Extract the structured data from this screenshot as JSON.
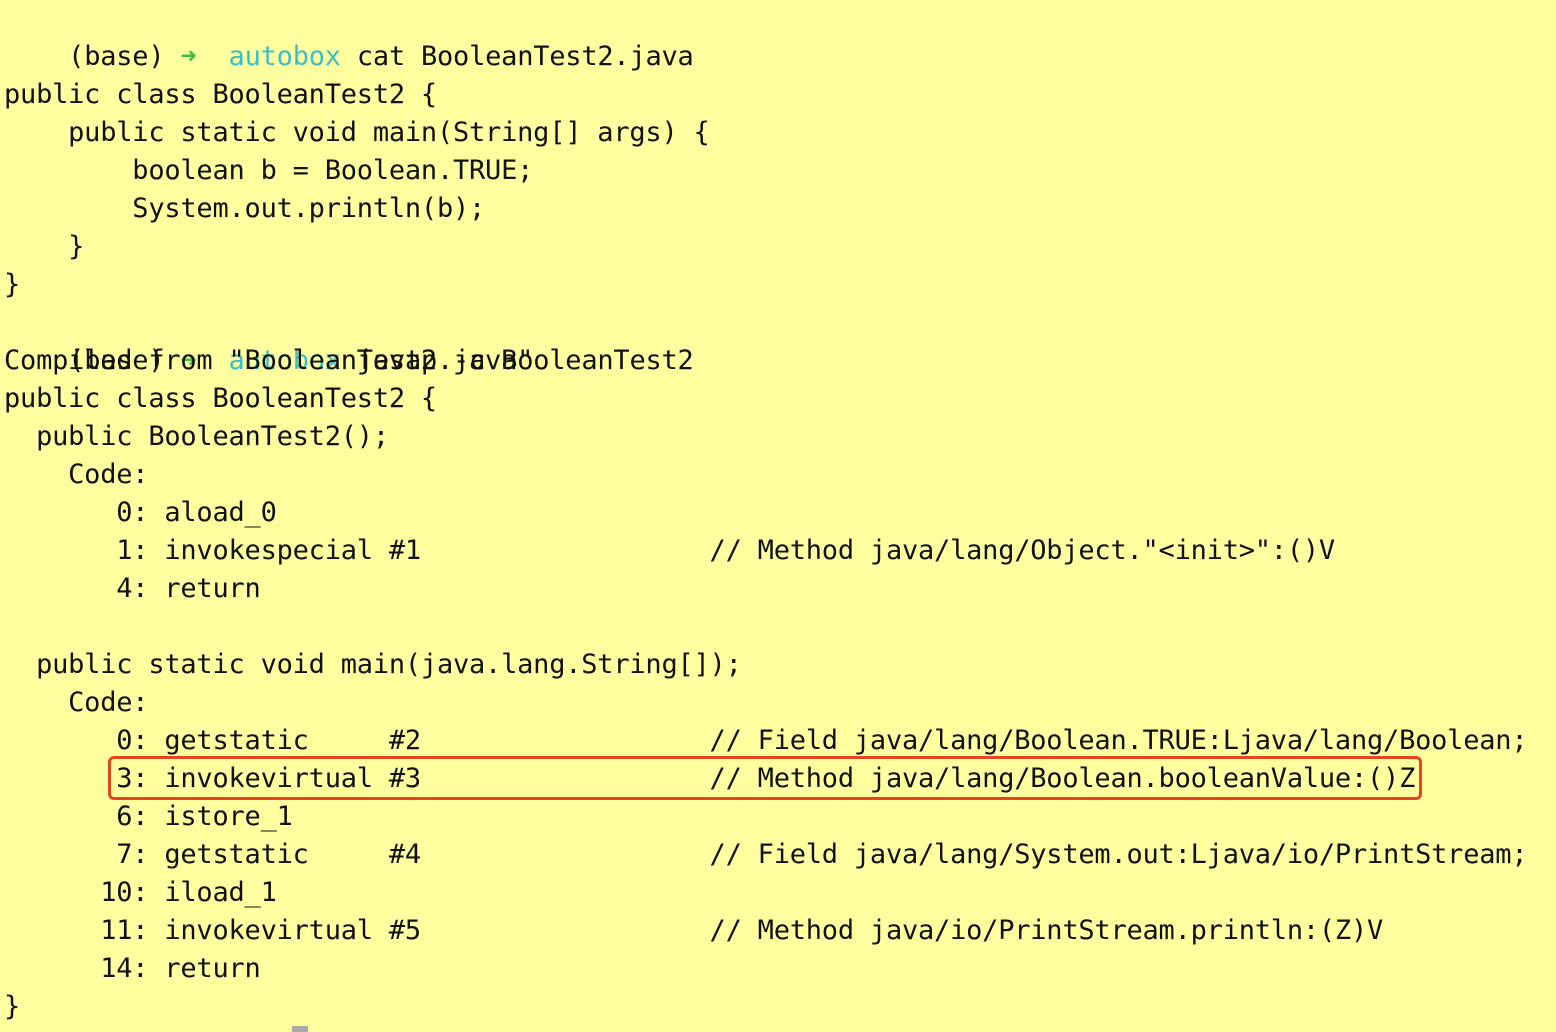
{
  "prompt": {
    "env": "(base)",
    "arrow": "➜",
    "dir": "autobox"
  },
  "commands": {
    "cat": "cat BooleanTest2.java",
    "javap": "javap -c BooleanTest2"
  },
  "source_lines": [
    "",
    "public class BooleanTest2 {",
    "    public static void main(String[] args) {",
    "        boolean b = Boolean.TRUE;",
    "        System.out.println(b);",
    "    }",
    "}"
  ],
  "javap_lines": [
    "Compiled from \"BooleanTest2.java\"",
    "public class BooleanTest2 {",
    "  public BooleanTest2();",
    "    Code:",
    "       0: aload_0",
    "       1: invokespecial #1                  // Method java/lang/Object.\"<init>\":()V",
    "       4: return",
    "",
    "  public static void main(java.lang.String[]);",
    "    Code:",
    "       0: getstatic     #2                  // Field java/lang/Boolean.TRUE:Ljava/lang/Boolean;",
    "       3: invokevirtual #3                  // Method java/lang/Boolean.booleanValue:()Z",
    "       6: istore_1",
    "       7: getstatic     #4                  // Field java/lang/System.out:Ljava/io/PrintStream;",
    "      10: iload_1",
    "      11: invokevirtual #5                  // Method java/io/PrintStream.println:(Z)V",
    "      14: return",
    "}"
  ],
  "highlighted_line": "       3: invokevirtual #3                  // Method java/lang/Boolean.booleanValue:()Z",
  "colors": {
    "background": "#ffff9f",
    "prompt_arrow": "#3fbf3f",
    "prompt_dir": "#3cbfc9",
    "highlight_border": "#e8441f"
  }
}
